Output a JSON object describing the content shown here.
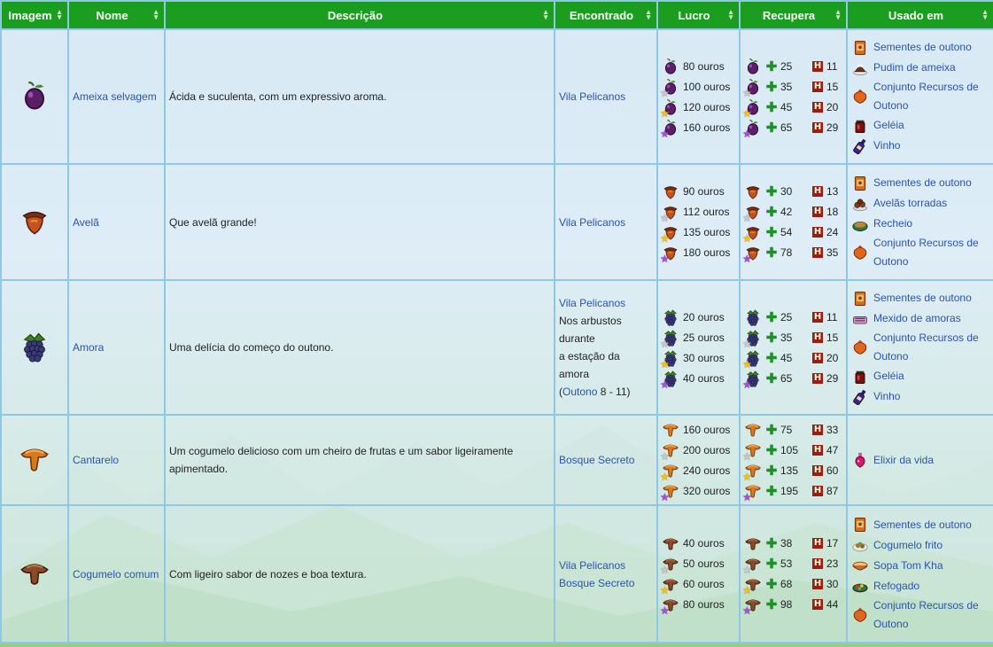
{
  "headers": [
    "Imagem",
    "Nome",
    "Descrição",
    "Encontrado",
    "Lucro",
    "Recupera",
    "Usado em"
  ],
  "rows": [
    {
      "name": "Ameixa selvagem",
      "icon": "plum-icon",
      "description": "Ácida e suculenta, com um expressivo aroma.",
      "found": [
        "Vila Pelicanos"
      ],
      "sell": [
        "80 ouros",
        "100 ouros",
        "120 ouros",
        "160 ouros"
      ],
      "energy": [
        "25",
        "35",
        "45",
        "65"
      ],
      "health": [
        "11",
        "15",
        "20",
        "29"
      ],
      "used": [
        "Sementes de outono",
        "Pudim de ameixa",
        "Conjunto Recursos de Outono",
        "Geléia",
        "Vinho"
      ]
    },
    {
      "name": "Avelã",
      "icon": "hazelnut-icon",
      "description": "Que avelã grande!",
      "found": [
        "Vila Pelicanos"
      ],
      "sell": [
        "90 ouros",
        "112 ouros",
        "135 ouros",
        "180 ouros"
      ],
      "energy": [
        "30",
        "42",
        "54",
        "78"
      ],
      "health": [
        "13",
        "18",
        "24",
        "35"
      ],
      "used": [
        "Sementes de outono",
        "Avelãs torradas",
        "Recheio",
        "Conjunto Recursos de Outono"
      ]
    },
    {
      "name": "Amora",
      "icon": "blackberry-icon",
      "description": "Uma delícia do começo do outono.",
      "found_link": "Vila Pelicanos",
      "found_text": [
        "Nos arbustos",
        "durante",
        "a estação da",
        "amora"
      ],
      "found_paren_open": "(",
      "found_season": "Outono",
      "found_days": " 8 - 11)",
      "sell": [
        "20 ouros",
        "25 ouros",
        "30 ouros",
        "40 ouros"
      ],
      "energy": [
        "25",
        "35",
        "45",
        "65"
      ],
      "health": [
        "11",
        "15",
        "20",
        "29"
      ],
      "used": [
        "Sementes de outono",
        "Mexido de amoras",
        "Conjunto Recursos de Outono",
        "Geléia",
        "Vinho"
      ]
    },
    {
      "name": "Cantarelo",
      "icon": "chanterelle-icon",
      "description": "Um cogumelo delicioso com um cheiro de frutas e um sabor ligeiramente apimentado.",
      "found": [
        "Bosque Secreto"
      ],
      "sell": [
        "160 ouros",
        "200 ouros",
        "240 ouros",
        "320 ouros"
      ],
      "energy": [
        "75",
        "105",
        "135",
        "195"
      ],
      "health": [
        "33",
        "47",
        "60",
        "87"
      ],
      "used": [
        "Elixir da vida"
      ]
    },
    {
      "name": "Cogumelo comum",
      "icon": "common-mushroom-icon",
      "description": "Com ligeiro sabor de nozes e boa textura.",
      "found": [
        "Vila Pelicanos",
        "Bosque Secreto"
      ],
      "sell": [
        "40 ouros",
        "50 ouros",
        "60 ouros",
        "80 ouros"
      ],
      "energy": [
        "38",
        "53",
        "68",
        "98"
      ],
      "health": [
        "17",
        "23",
        "30",
        "44"
      ],
      "used": [
        "Sementes de outono",
        "Cogumelo frito",
        "Sopa Tom Kha",
        "Refogado",
        "Conjunto Recursos de Outono"
      ]
    }
  ],
  "colors": {
    "header_green": "#1b9e1f",
    "link_blue": "#2a55a8",
    "border": "#8fc8e6"
  }
}
